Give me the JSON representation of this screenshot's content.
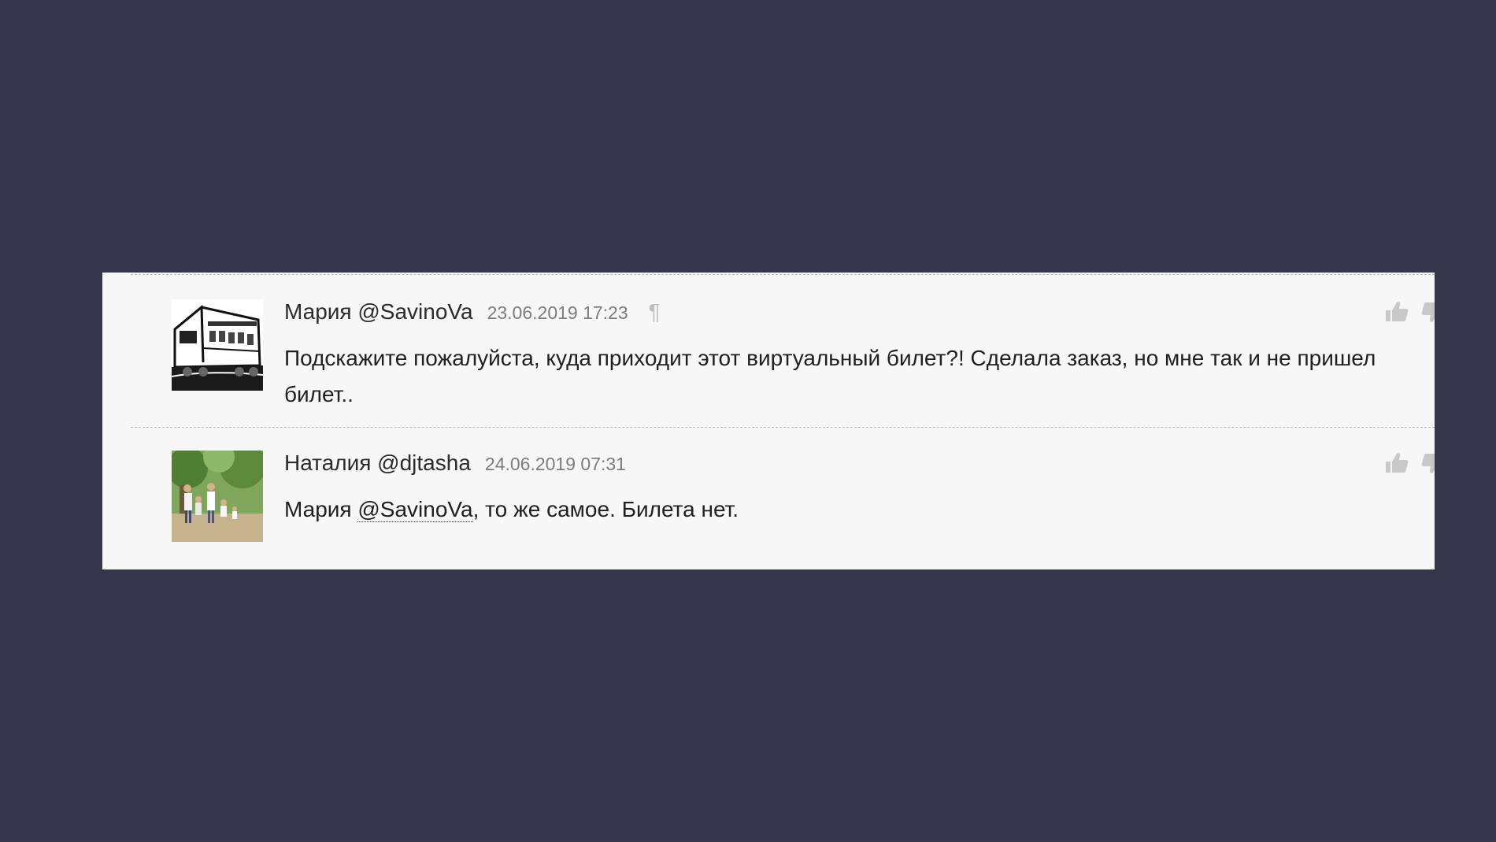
{
  "comments": [
    {
      "author": "Мария @SavinoVa",
      "date": "23.06.2019 17:23",
      "permalink_symbol": "¶",
      "text": "Подскажите пожалуйста, куда приходит этот виртуальный билет?! Сделала заказ, но мне так и не пришел билет..",
      "avatar_icon": "train-avatar",
      "vote_icons": [
        "thumbs-up-icon",
        "thumbs-down-icon"
      ]
    },
    {
      "author": "Наталия @djtasha",
      "date": "24.06.2019 07:31",
      "reply_to_name": "Мария",
      "mention": "@SavinoVa",
      "text_after_mention": ", то же самое. Билета нет.",
      "avatar_icon": "family-photo-avatar",
      "vote_icons": [
        "thumbs-up-icon",
        "thumbs-down-icon"
      ]
    }
  ],
  "colors": {
    "background": "#35354c",
    "panel": "#f7f7f7",
    "text": "#202020",
    "date": "#7c7c7c",
    "icons": "#c8c8c8"
  }
}
